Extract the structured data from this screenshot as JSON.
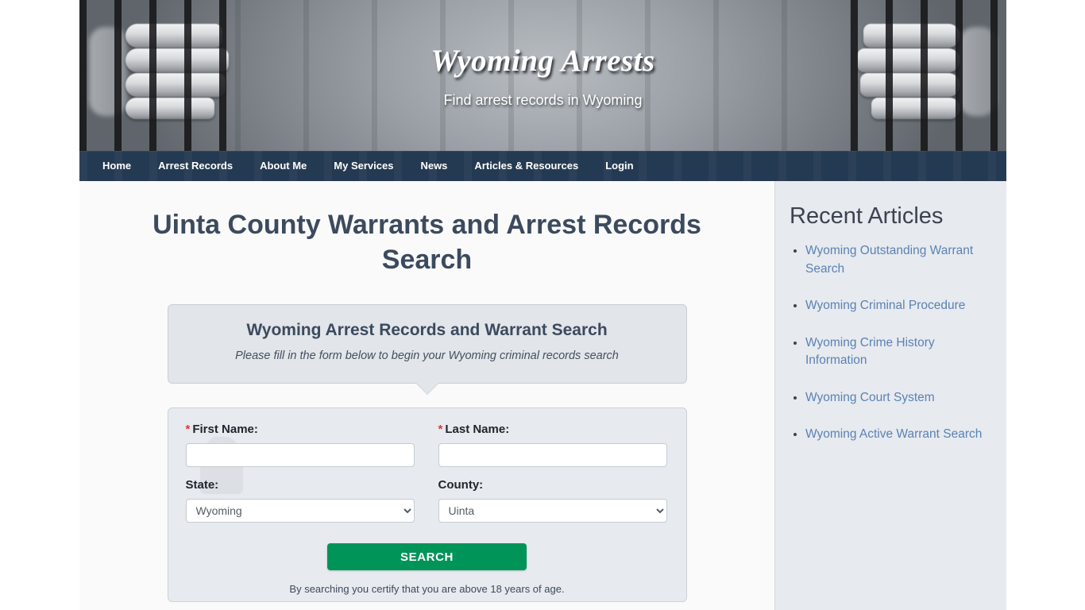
{
  "site": {
    "title": "Wyoming Arrests",
    "tagline": "Find arrest records in Wyoming"
  },
  "nav": {
    "items": [
      {
        "label": "Home"
      },
      {
        "label": "Arrest Records"
      },
      {
        "label": "About Me"
      },
      {
        "label": "My Services"
      },
      {
        "label": "News"
      },
      {
        "label": "Articles & Resources"
      },
      {
        "label": "Login"
      }
    ]
  },
  "main": {
    "page_title": "Uinta County Warrants and Arrest Records Search",
    "bubble": {
      "heading": "Wyoming Arrest Records and Warrant Search",
      "subheading": "Please fill in the form below to begin your Wyoming criminal records search"
    },
    "form": {
      "first_name": {
        "label": "First Name:",
        "required_marker": "*",
        "value": "",
        "placeholder": ""
      },
      "last_name": {
        "label": "Last Name:",
        "required_marker": "*",
        "value": "",
        "placeholder": ""
      },
      "state": {
        "label": "State:",
        "value": "Wyoming",
        "options": [
          "Wyoming"
        ]
      },
      "county": {
        "label": "County:",
        "value": "Uinta",
        "options": [
          "Uinta"
        ]
      },
      "submit_label": "SEARCH",
      "disclaimer": "By searching you certify that you are above 18 years of age."
    }
  },
  "sidebar": {
    "title": "Recent Articles",
    "articles": [
      {
        "label": "Wyoming Outstanding Warrant Search"
      },
      {
        "label": "Wyoming Criminal Procedure"
      },
      {
        "label": "Wyoming Crime History Information"
      },
      {
        "label": "Wyoming Court System"
      },
      {
        "label": "Wyoming Active Warrant Search"
      }
    ]
  },
  "colors": {
    "nav_background": "#243a52",
    "title_text": "#3c4a5e",
    "search_button": "#009459",
    "link": "#5a82b5",
    "sidebar_background": "#e7eaee",
    "required_marker": "#d63b3b"
  }
}
